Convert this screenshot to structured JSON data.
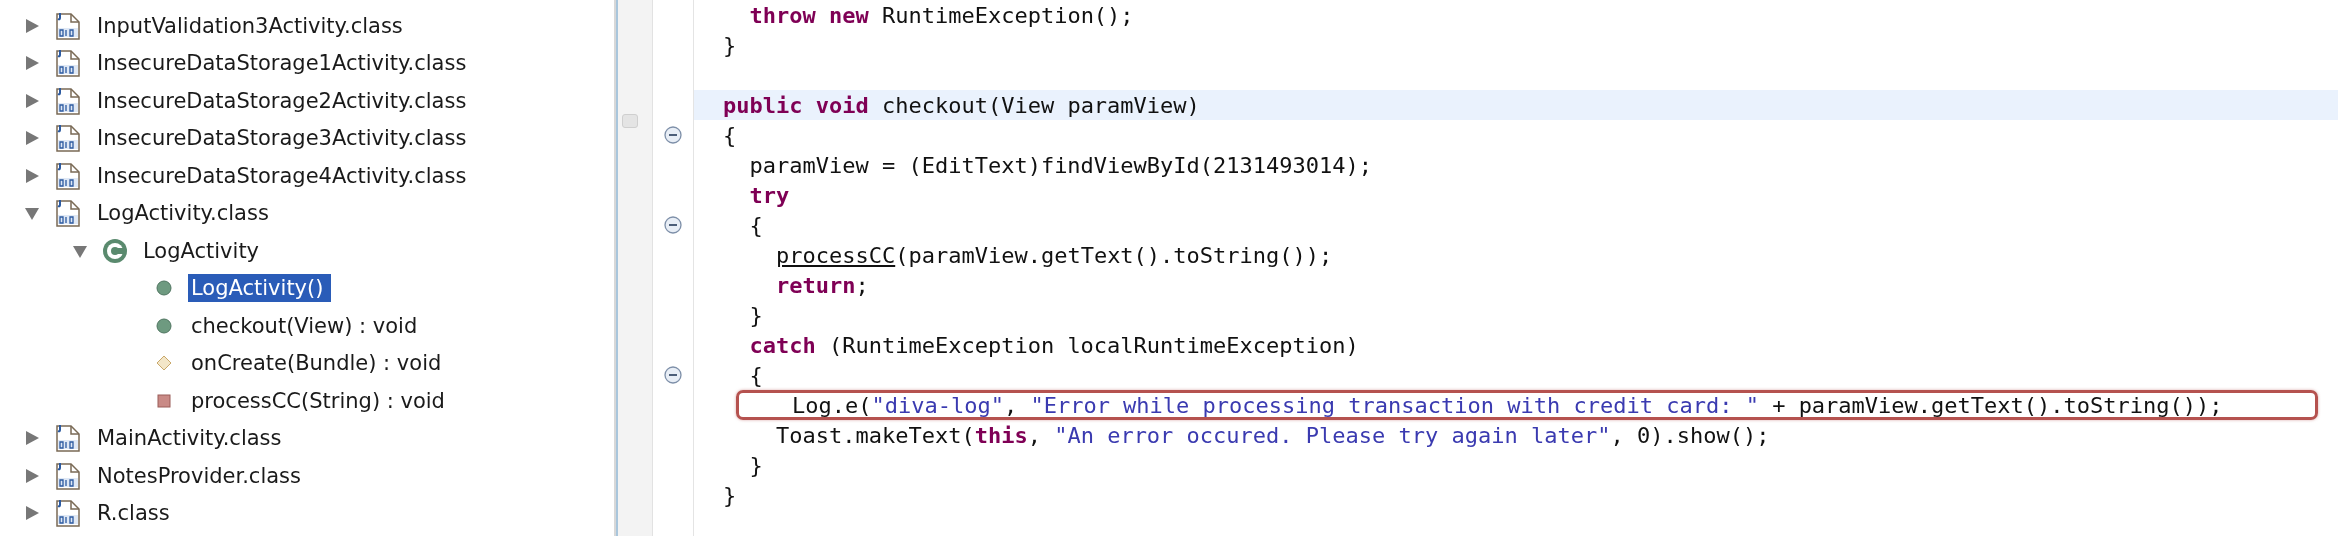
{
  "tree": [
    {
      "label": "InputValidation3Activity.class",
      "kind": "class_file",
      "expanded": false,
      "selected": false
    },
    {
      "label": "InsecureDataStorage1Activity.class",
      "kind": "class_file",
      "expanded": false,
      "selected": false
    },
    {
      "label": "InsecureDataStorage2Activity.class",
      "kind": "class_file",
      "expanded": false,
      "selected": false
    },
    {
      "label": "InsecureDataStorage3Activity.class",
      "kind": "class_file",
      "expanded": false,
      "selected": false
    },
    {
      "label": "InsecureDataStorage4Activity.class",
      "kind": "class_file",
      "expanded": false,
      "selected": false
    },
    {
      "label": "LogActivity.class",
      "kind": "class_file",
      "expanded": true,
      "selected": false,
      "children": [
        {
          "label": "LogActivity",
          "kind": "class",
          "expanded": true,
          "selected": false,
          "children": [
            {
              "label": "LogActivity()",
              "kind": "public_method",
              "selected": true
            },
            {
              "label": "checkout(View) : void",
              "kind": "public_method",
              "selected": false
            },
            {
              "label": "onCreate(Bundle) : void",
              "kind": "protected_method",
              "selected": false
            },
            {
              "label": "processCC(String) : void",
              "kind": "private_method",
              "selected": false
            }
          ]
        }
      ]
    },
    {
      "label": "MainActivity.class",
      "kind": "class_file",
      "expanded": false,
      "selected": false
    },
    {
      "label": "NotesProvider.class",
      "kind": "class_file",
      "expanded": false,
      "selected": false
    },
    {
      "label": "R.class",
      "kind": "class_file",
      "expanded": false,
      "selected": false
    }
  ],
  "code": [
    {
      "fold_marker": false,
      "highlighted": false,
      "boxed": false,
      "tokens": [
        {
          "kind": "keyword",
          "text": "  throw new"
        },
        {
          "kind": "plain",
          "text": " RuntimeException();"
        }
      ]
    },
    {
      "fold_marker": false,
      "highlighted": false,
      "boxed": false,
      "tokens": [
        {
          "kind": "plain",
          "text": "}"
        }
      ]
    },
    {
      "fold_marker": false,
      "highlighted": false,
      "boxed": false
    },
    {
      "fold_marker": false,
      "highlighted": true,
      "boxed": false,
      "tokens": [
        {
          "kind": "keyword",
          "text": "public void"
        },
        {
          "kind": "plain",
          "text": " checkout(View paramView)"
        }
      ]
    },
    {
      "fold_marker": true,
      "highlighted": false,
      "boxed": false,
      "tokens": [
        {
          "kind": "plain",
          "text": "{"
        }
      ]
    },
    {
      "fold_marker": false,
      "highlighted": false,
      "boxed": false,
      "tokens": [
        {
          "kind": "plain",
          "text": "  paramView = (EditText)findViewById(2131493014);"
        }
      ]
    },
    {
      "fold_marker": false,
      "highlighted": false,
      "boxed": false,
      "tokens": [
        {
          "kind": "keyword",
          "text": "  try"
        }
      ]
    },
    {
      "fold_marker": true,
      "highlighted": false,
      "boxed": false,
      "tokens": [
        {
          "kind": "plain",
          "text": "  {"
        }
      ]
    },
    {
      "fold_marker": false,
      "highlighted": false,
      "boxed": false,
      "tokens": [
        {
          "kind": "link",
          "text": "    processCC"
        },
        {
          "kind": "plain",
          "text": "(paramView.getText().toString());"
        }
      ]
    },
    {
      "fold_marker": false,
      "highlighted": false,
      "boxed": false,
      "tokens": [
        {
          "kind": "keyword",
          "text": "    return"
        },
        {
          "kind": "plain",
          "text": ";"
        }
      ]
    },
    {
      "fold_marker": false,
      "highlighted": false,
      "boxed": false,
      "tokens": [
        {
          "kind": "plain",
          "text": "  }"
        }
      ]
    },
    {
      "fold_marker": false,
      "highlighted": false,
      "boxed": false,
      "tokens": [
        {
          "kind": "keyword",
          "text": "  catch"
        },
        {
          "kind": "plain",
          "text": " (RuntimeException localRuntimeException)"
        }
      ]
    },
    {
      "fold_marker": true,
      "highlighted": false,
      "boxed": false,
      "tokens": [
        {
          "kind": "plain",
          "text": "  {"
        }
      ]
    },
    {
      "fold_marker": false,
      "highlighted": false,
      "boxed": true,
      "tokens": [
        {
          "kind": "plain",
          "text": "    Log.e("
        },
        {
          "kind": "string",
          "text": "\"diva-log\""
        },
        {
          "kind": "plain",
          "text": ", "
        },
        {
          "kind": "string",
          "text": "\"Error while processing transaction with credit card: \""
        },
        {
          "kind": "plain",
          "text": " + paramView.getText().toString());"
        }
      ]
    },
    {
      "fold_marker": false,
      "highlighted": false,
      "boxed": false,
      "tokens": [
        {
          "kind": "plain",
          "text": "    Toast.makeText("
        },
        {
          "kind": "keyword",
          "text": "this"
        },
        {
          "kind": "plain",
          "text": ", "
        },
        {
          "kind": "string",
          "text": "\"An error occured. Please try again later\""
        },
        {
          "kind": "plain",
          "text": ", 0).show();"
        }
      ]
    },
    {
      "fold_marker": false,
      "highlighted": false,
      "boxed": false,
      "tokens": [
        {
          "kind": "plain",
          "text": "  }"
        }
      ]
    },
    {
      "fold_marker": false,
      "highlighted": false,
      "boxed": false,
      "tokens": [
        {
          "kind": "plain",
          "text": "}"
        }
      ]
    }
  ]
}
